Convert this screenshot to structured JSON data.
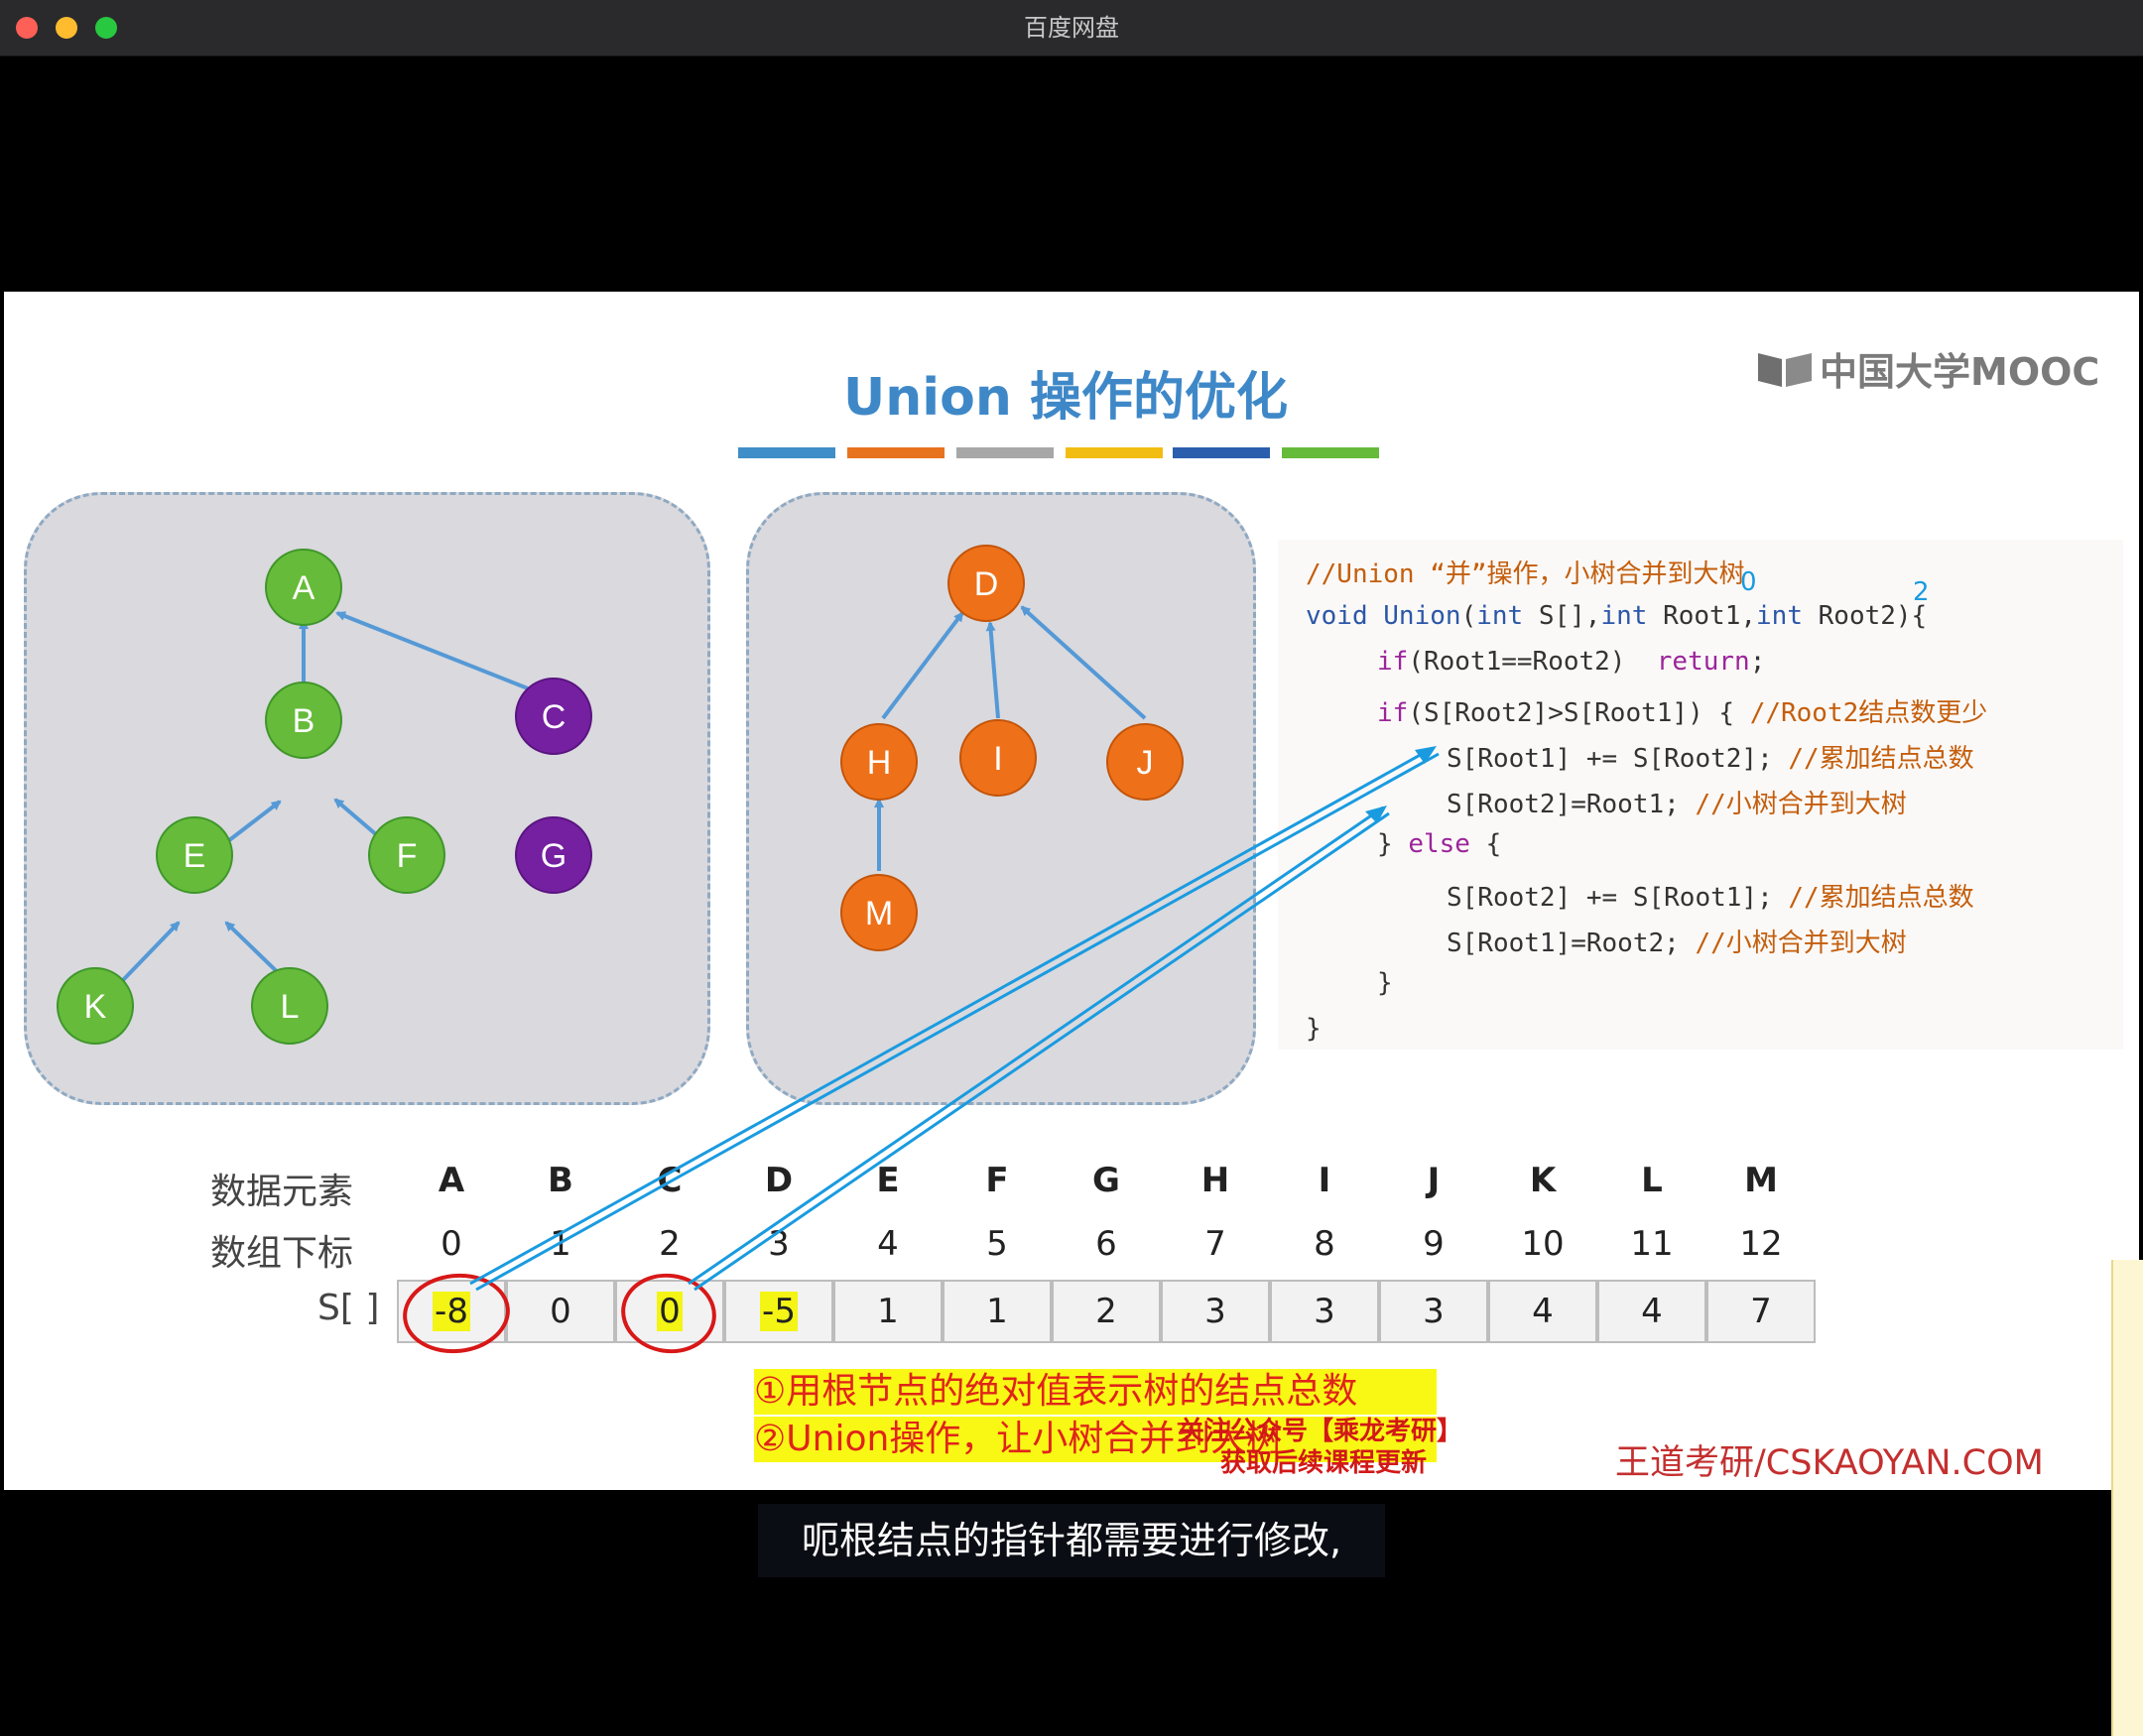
{
  "window": {
    "title": "百度网盘"
  },
  "slide": {
    "title": "Union 操作的优化",
    "logo_text": "中国大学MOOC",
    "color_bar": [
      "#3f8ec8",
      "#e8731e",
      "#a7a7a7",
      "#f2bd12",
      "#2b5fae",
      "#66bb3a"
    ],
    "tree1": {
      "nodes": [
        "A",
        "B",
        "C",
        "E",
        "F",
        "G",
        "K",
        "L"
      ]
    },
    "tree2": {
      "nodes": [
        "D",
        "H",
        "I",
        "J",
        "M"
      ]
    },
    "code": {
      "lines": [
        "//Union “并”操作，小树合并到大树",
        "void Union(int S[],int Root1,int Root2){",
        "if(Root1==Root2)  return;",
        "if(S[Root2]>S[Root1]) { //Root2结点数更少",
        "S[Root1] += S[Root2]; //累加结点总数",
        "S[Root2]=Root1; //小树合并到大树",
        "} else {",
        "S[Root2] += S[Root1]; //累加结点总数",
        "S[Root1]=Root2; //小树合并到大树",
        "}",
        "}"
      ],
      "annotations": [
        "0",
        "2"
      ]
    },
    "table": {
      "label_elements": "数据元素",
      "label_index": "数组下标",
      "label_s": "S[ ]",
      "elements": [
        "A",
        "B",
        "C",
        "D",
        "E",
        "F",
        "G",
        "H",
        "I",
        "J",
        "K",
        "L",
        "M"
      ],
      "indices": [
        "0",
        "1",
        "2",
        "3",
        "4",
        "5",
        "6",
        "7",
        "8",
        "9",
        "10",
        "11",
        "12"
      ],
      "s_values": [
        "-8",
        "0",
        "0",
        "-5",
        "1",
        "1",
        "2",
        "3",
        "3",
        "3",
        "4",
        "4",
        "7"
      ]
    },
    "notes": [
      "①用根节点的绝对值表示树的结点总数",
      "②Union操作，让小树合并到大树"
    ],
    "watermark": [
      "关注公众号【乘龙考研】",
      "获取后续课程更新"
    ],
    "brand": "王道考研/CSKAOYAN.COM"
  },
  "subtitle": "呃根结点的指针都需要进行修改,"
}
